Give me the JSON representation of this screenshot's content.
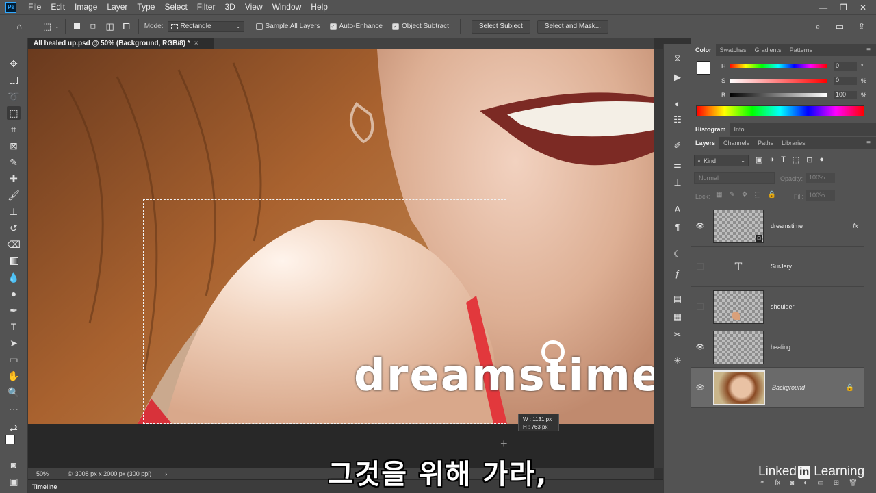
{
  "app": {
    "logo": "Ps"
  },
  "menu": [
    "File",
    "Edit",
    "Image",
    "Layer",
    "Type",
    "Select",
    "Filter",
    "3D",
    "View",
    "Window",
    "Help"
  ],
  "options": {
    "mode_label": "Mode:",
    "mode_value": "Rectangle",
    "sample_all_layers": "Sample All Layers",
    "auto_enhance": "Auto-Enhance",
    "object_subtract": "Object Subtract",
    "select_subject": "Select Subject",
    "select_and_mask": "Select and Mask..."
  },
  "document": {
    "tab_title": "All healed up.psd @ 50% (Background, RGB/8) *",
    "close": "×"
  },
  "canvas": {
    "watermark": "dreamstime.c",
    "size_w": "W :   1131 px",
    "size_h": "H :   763 px"
  },
  "status": {
    "zoom": "50%",
    "doc_size": "3008 px x 2000 px (300 ppi)"
  },
  "timeline_label": "Timeline",
  "color_panel": {
    "tabs": [
      "Color",
      "Swatches",
      "Gradients",
      "Patterns"
    ],
    "h_label": "H",
    "h_value": "0",
    "h_unit": "°",
    "s_label": "S",
    "s_value": "0",
    "s_unit": "%",
    "b_label": "B",
    "b_value": "100",
    "b_unit": "%"
  },
  "histogram_tabs": [
    "Histogram",
    "Info"
  ],
  "layers_panel": {
    "tabs": [
      "Layers",
      "Channels",
      "Paths",
      "Libraries"
    ],
    "kind": "Kind",
    "blend_mode": "Normal",
    "opacity_label": "Opacity:",
    "opacity_value": "100%",
    "lock_label": "Lock:",
    "fill_label": "Fill:",
    "fill_value": "100%",
    "layers": [
      {
        "name": "dreamstime",
        "visible": true
      },
      {
        "name": "SurJery",
        "visible": false
      },
      {
        "name": "shoulder",
        "visible": false
      },
      {
        "name": "healing",
        "visible": true
      },
      {
        "name": "Background",
        "visible": true
      }
    ]
  },
  "subtitle": "그것을 위해 가라,",
  "brand": {
    "pre": "Linked",
    "in": "in",
    "post": "Learning"
  }
}
